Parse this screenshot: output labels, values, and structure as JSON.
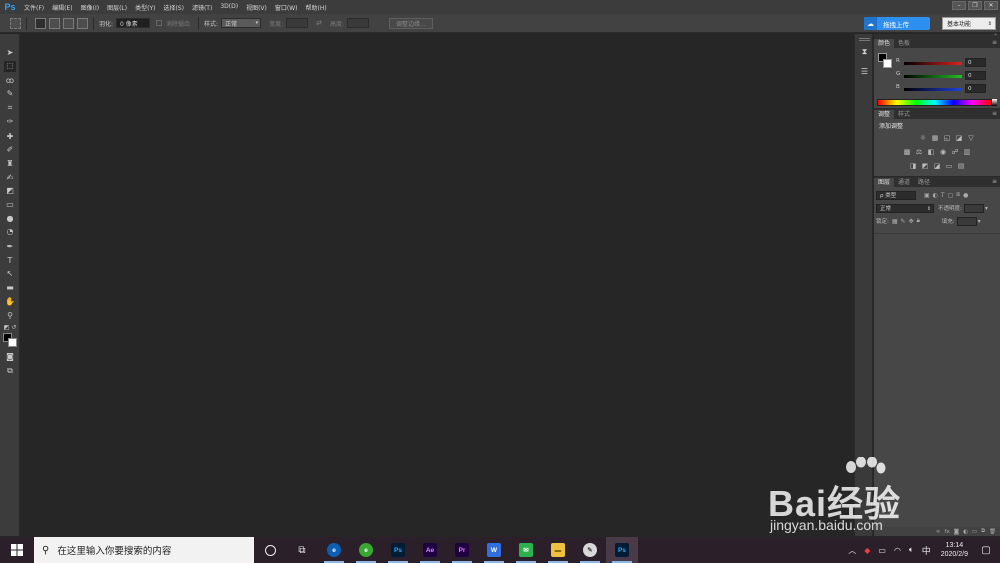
{
  "app": {
    "logo": "Ps"
  },
  "menu": [
    "文件(F)",
    "编辑(E)",
    "图像(I)",
    "图层(L)",
    "类型(Y)",
    "选择(S)",
    "滤镜(T)",
    "3D(D)",
    "视图(V)",
    "窗口(W)",
    "帮助(H)"
  ],
  "window_controls": {
    "minimize": "–",
    "restore": "❐",
    "close": "✕"
  },
  "options_bar": {
    "feather_label": "羽化:",
    "feather_value": "0 像素",
    "antialias_label": "消除锯齿",
    "style_label": "样式:",
    "style_value": "正常",
    "width_label": "宽度:",
    "height_label": "高度:",
    "refine_edge": "调整边缘...",
    "upload_button": "拖拽上传",
    "workspace": "基本功能"
  },
  "color_panel": {
    "tabs": [
      "颜色",
      "色板"
    ],
    "rows": [
      {
        "label": "R",
        "value": "0",
        "color": "#e02020"
      },
      {
        "label": "G",
        "value": "0",
        "color": "#20c020"
      },
      {
        "label": "B",
        "value": "0",
        "color": "#2040e0"
      }
    ]
  },
  "adjust_panel": {
    "tabs": [
      "调整",
      "样式"
    ],
    "title": "添加调整"
  },
  "layers_panel": {
    "tabs": [
      "图层",
      "通道",
      "路径"
    ],
    "kind_label": "ρ 类型",
    "blend_mode": "正常",
    "opacity_label": "不透明度:",
    "lock_label": "锁定:",
    "fill_label": "填充:"
  },
  "taskbar": {
    "search_placeholder": "在这里输入你要搜索的内容",
    "apps": [
      {
        "name": "edge",
        "label": "e",
        "bg": "#0a5fb4",
        "fg": "#ffffff"
      },
      {
        "name": "browser-360",
        "label": "e",
        "bg": "#3aa830",
        "fg": "#ffffff"
      },
      {
        "name": "photoshop",
        "label": "Ps",
        "bg": "#001d34",
        "fg": "#31a8ff"
      },
      {
        "name": "after-effects",
        "label": "Ae",
        "bg": "#1f0040",
        "fg": "#d291ff"
      },
      {
        "name": "premiere",
        "label": "Pr",
        "bg": "#1f0040",
        "fg": "#ea77ff"
      },
      {
        "name": "wps",
        "label": "W",
        "bg": "#2f6fe0",
        "fg": "#ffffff"
      },
      {
        "name": "wechat",
        "label": "✉",
        "bg": "#2bb24c",
        "fg": "#ffffff"
      },
      {
        "name": "file-explorer",
        "label": "▬",
        "bg": "#f0c040",
        "fg": "#8a6a10"
      },
      {
        "name": "feather-app",
        "label": "✎",
        "bg": "#d8d8d8",
        "fg": "#555555"
      },
      {
        "name": "photoshop-active",
        "label": "Ps",
        "bg": "#001d34",
        "fg": "#31a8ff"
      }
    ],
    "ime": "中",
    "time": "13:14",
    "date": "2020/2/9"
  },
  "watermark": {
    "brand": "Bai经验",
    "url": "jingyan.baidu.com"
  }
}
